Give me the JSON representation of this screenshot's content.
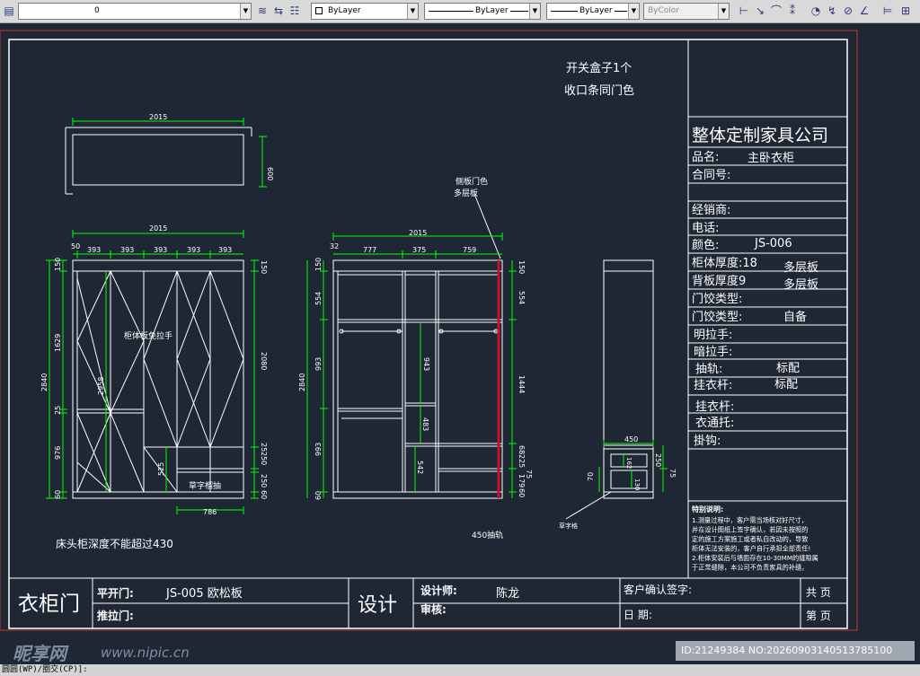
{
  "toolbar": {
    "layer_value": "0",
    "color_value": "ByLayer",
    "linetype_value": "ByLayer",
    "lineweight_value": "ByLayer",
    "plotstyle_value": "ByColor",
    "icons": [
      "layer-manager-icon",
      "lightbulb-icon",
      "sun-icon",
      "lock-icon",
      "square-color-icon",
      "layer-state-icon",
      "layer-prev-icon",
      "match-layer-icon",
      "dim-linear-icon",
      "dim-aligned-icon",
      "dim-arc-icon",
      "dim-ordinate-icon",
      "dim-radius-icon",
      "dim-jogged-icon",
      "dim-diameter-icon",
      "dim-angular-icon",
      "dim-baseline-icon",
      "dim-continue-icon"
    ]
  },
  "notes": {
    "switch_box": "开关盒子1个",
    "edge_strip": "收口条同门色",
    "side_panel_1": "侧板门色",
    "side_panel_2": "多层板",
    "handle_note": "柜体板免拉手",
    "drawer_label": "草字榴抽",
    "bedside": "床头柜深度不能超过430",
    "rail": "450抽轨",
    "small_label": "草字格"
  },
  "dimensions": {
    "top_width": "2015",
    "top_height": "600",
    "front_width": "2015",
    "door_50": "50",
    "door_393_1": "393",
    "door_393_2": "393",
    "door_393_3": "393",
    "door_393_4": "393",
    "door_393_5": "393",
    "left_150": "150",
    "left_1629": "1629",
    "left_2840": "2840",
    "left_25": "25",
    "left_976": "976",
    "left_60": "60",
    "right_150": "150",
    "right_2080": "2080",
    "right_25": "25",
    "right_250a": "250",
    "right_250b": "250",
    "right_60": "60",
    "diag_2958": "2958",
    "bottom_786": "786",
    "small_525": "525",
    "int_width": "2015",
    "int_32": "32",
    "int_777": "777",
    "int_375": "375",
    "int_759": "759",
    "int_left_150": "150",
    "int_left_554": "554",
    "int_left_2840": "2840",
    "int_left_993a": "993",
    "int_left_993b": "993",
    "int_left_60": "60",
    "int_right_150": "150",
    "int_right_554": "554",
    "int_right_1444": "1444",
    "int_right_68": "68",
    "int_right_225": "225",
    "int_right_179": "179",
    "int_right_60": "60",
    "int_right_75": "75",
    "int_943": "943",
    "int_483": "483",
    "int_542": "542",
    "side_450": "450",
    "side_250": "250",
    "side_75": "75",
    "side_70": "70",
    "side_162": "162",
    "side_130": "130"
  },
  "title_block": {
    "company": "整体定制家具公司",
    "product_label": "品名:",
    "product_value": "主卧衣柜",
    "contract": "合同号:",
    "dealer": "经销商:",
    "phone": "电话:",
    "color_label": "颜色:",
    "color_value": "JS-006",
    "cabinet_thickness": "柜体厚度:18",
    "cabinet_material": "多层板",
    "back_thickness": "背板厚度9",
    "back_material": "多层板",
    "hinge_type1": "门饺类型:",
    "hinge_type2": "门饺类型:",
    "hinge_value": "自备",
    "visible_handle": "明拉手:",
    "hidden_handle": "暗拉手:",
    "drawer_rail": "抽轨:",
    "drawer_rail_value": "标配",
    "hanger_rod1": "挂衣杆:",
    "hanger_rod1_value": "标配",
    "hanger_rod2": "挂衣杆:",
    "pull_rack": "衣通托:",
    "hook": "掛钩:",
    "notes_title": "特别说明:",
    "notes_lines": [
      "1.测量过程中，客户需当场核对好尺寸，",
      "并在设计图纸上签字确认，若因未按照的",
      "定的施工方案施工或者私自改动的，导致",
      "柜体无法安装的，客户自行承担全部责任!",
      "2.柜体安装后与墙面存在10-30MM的缝隙属",
      "于正常缝隙，本公司不负责家具的补缝。"
    ]
  },
  "bottom_block": {
    "title": "衣柜门",
    "flat_door_label": "平开门:",
    "flat_door_value": "JS-005 欧松板",
    "sliding_door_label": "推拉门:",
    "design": "设计",
    "designer_label": "设计师:",
    "designer_value": "陈龙",
    "review_label": "审核:",
    "customer_sign": "客户确认签字:",
    "date_label": "日    期:",
    "total_pages": "共    页",
    "page_no": "第    页"
  },
  "watermark": {
    "brand": "昵享网",
    "url": "www.nipic.cn",
    "id_line": "ID:21249384 NO:20260903140513785100"
  },
  "command_line": "圆圆(WP)/圈交(CP)]:",
  "colors": {
    "background": "#1f2735",
    "line": "#ffffff",
    "dimension": "#00ff00",
    "border_red": "#c0392b",
    "red_panel": "#c8102e"
  }
}
